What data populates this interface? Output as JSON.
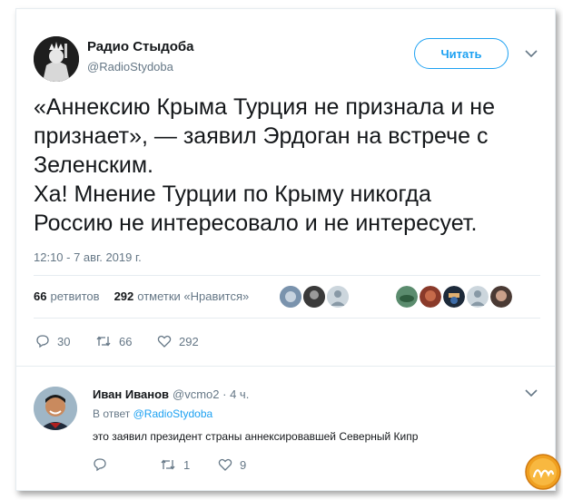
{
  "tweet": {
    "author_name": "Радио Стыдоба",
    "author_handle": "@RadioStydoba",
    "follow_label": "Читать",
    "text_lines": [
      "«Аннексию Крыма Турция не признала и не",
      "признает», — заявил Эрдоган на встрече с",
      "Зеленским.",
      "Ха! Мнение Турции по Крыму никогда",
      "Россию не интересовало и не интересует."
    ],
    "timestamp": "12:10 - 7 авг. 2019 г.",
    "stats": {
      "retweets_count": "66",
      "retweets_label": "ретвитов",
      "likes_count": "292",
      "likes_label": "отметки «Нравится»"
    },
    "actions": {
      "replies": "30",
      "retweets": "66",
      "likes": "292"
    }
  },
  "reply": {
    "author_name": "Иван Иванов",
    "author_handle": "@vcmo2",
    "time": "4 ч.",
    "in_reply_prefix": "В ответ",
    "in_reply_handle": "@RadioStydoba",
    "text": "это заявил президент страны аннексировавшей Северный Кипр",
    "actions": {
      "replies": "",
      "retweets": "1",
      "likes": "9"
    }
  },
  "icons": {
    "reply": "reply-icon",
    "retweet": "retweet-icon",
    "like": "heart-icon",
    "more": "chevron-down-icon"
  },
  "colors": {
    "accent": "#1da1f2",
    "muted": "#657786",
    "text": "#14171a",
    "border": "#e6ecf0"
  }
}
